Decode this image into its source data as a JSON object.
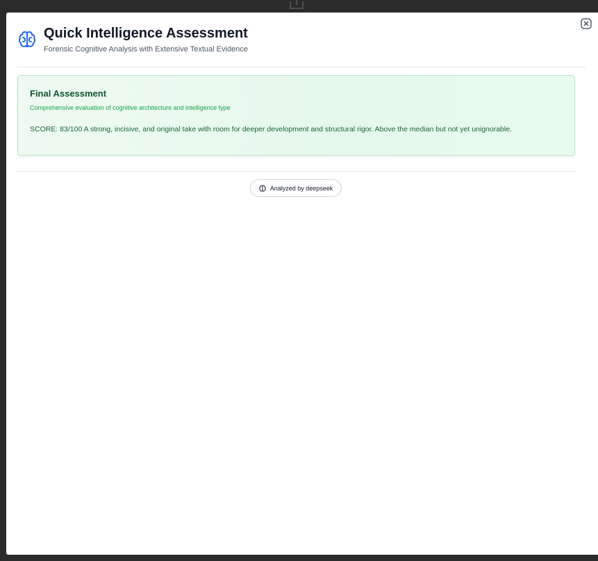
{
  "header": {
    "title": "Quick Intelligence Assessment",
    "subtitle": "Forensic Cognitive Analysis with Extensive Textual Evidence",
    "icon": "brain-icon",
    "icon_color": "#2563eb"
  },
  "assessment": {
    "title": "Final Assessment",
    "subtitle": "Comprehensive evaluation of cognitive architecture and intelligence type",
    "body": "SCORE: 83/100 A strong, incisive, and original take with room for deeper development and structural rigor. Above the median but not yet unignorable.",
    "score": 83,
    "score_max": 100,
    "accent_color": "#16a34a"
  },
  "footer": {
    "badge_label": "Analyzed by deepseek",
    "badge_icon": "brain-icon"
  },
  "controls": {
    "close_icon": "close-icon"
  }
}
